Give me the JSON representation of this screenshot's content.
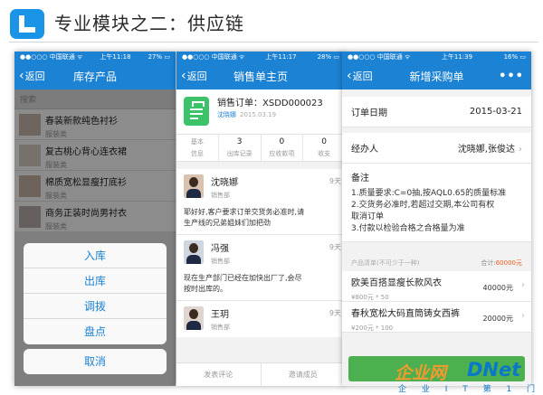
{
  "slide": {
    "title": "专业模块之二：供应链"
  },
  "watermark": {
    "brand_cn": "企业网",
    "brand_en": "DNet",
    "tagline": "企 业 I T 第 1 门 户"
  },
  "phone1": {
    "status": {
      "carrier": "●●○○○ 中国联通 ᯤ",
      "time": "上午11:18",
      "battery": "27% ▭"
    },
    "nav": {
      "back": "返回",
      "title": "库存产品"
    },
    "search_placeholder": "搜索",
    "products": [
      {
        "name": "春装新款纯色衬衫",
        "category": "服装类"
      },
      {
        "name": "复古桃心背心连衣裙",
        "category": "服装类"
      },
      {
        "name": "棉质宽松显瘦打底衫",
        "category": "服装类"
      },
      {
        "name": "商务正装时尚男衬衣",
        "category": "服装类"
      }
    ],
    "action_sheet": {
      "options": [
        "入库",
        "出库",
        "调拨",
        "盘点"
      ],
      "cancel": "取消"
    }
  },
  "phone2": {
    "status": {
      "carrier": "●●○○○ 中国联通 ᯤ",
      "time": "上午11:17",
      "battery": "28% ▭"
    },
    "nav": {
      "back": "返回",
      "title": "销售单主页"
    },
    "order": {
      "number": "销售订单：XSDD000023",
      "creator": "沈晓娜",
      "date": "2015.03.19"
    },
    "stats": [
      {
        "value": "基本",
        "label": "信息"
      },
      {
        "value": "3",
        "label": "出库记录"
      },
      {
        "value": "0",
        "label": "应收款项"
      },
      {
        "value": "0",
        "label": "收支"
      }
    ],
    "comments": [
      {
        "name": "沈晓娜",
        "dept": "销售部",
        "time": "9天",
        "text": [
          "耶好好,客户要求订单交货务必准时,请",
          "生产线的兄弟姐妹们加把劲"
        ]
      },
      {
        "name": "冯强",
        "dept": "销售部",
        "time": "9天",
        "text": [
          "现在生产部门已经在加快出厂了,会尽",
          "按时出库的。"
        ]
      },
      {
        "name": "王玥",
        "dept": "销售部",
        "time": "9天",
        "text": []
      }
    ],
    "footer": {
      "left": "发表评论",
      "right": "邀请成员"
    }
  },
  "phone3": {
    "status": {
      "carrier": "●●○○○ 中国联通 ᯤ",
      "time": "上午11:39",
      "battery": "16% ▭"
    },
    "nav": {
      "back": "返回",
      "title": "新增采购单",
      "more": "•••"
    },
    "order_date": {
      "label": "订单日期",
      "value": "2015-03-21"
    },
    "handler": {
      "label": "经办人",
      "value": "沈晓娜,张俊达"
    },
    "notes": {
      "label": "备注",
      "lines": [
        "1.质量要求:C=0抽,按AQL0.65的质量标准",
        "2.交货务必准时,若超过交期,本公司有权",
        "取消订单",
        "3.付款以检验合格之合格量为准"
      ]
    },
    "product_list": {
      "label": "产品清单(不可少于一种)",
      "total_label": "合计:",
      "total_value": "60000元",
      "items": [
        {
          "name": "欧美百搭显瘦长款风衣",
          "price": "¥800元 * 50",
          "amount": "40000元"
        },
        {
          "name": "春秋宽松大码直筒铸女西裤",
          "price": "¥200元 * 100",
          "amount": "20000元"
        }
      ]
    }
  }
}
